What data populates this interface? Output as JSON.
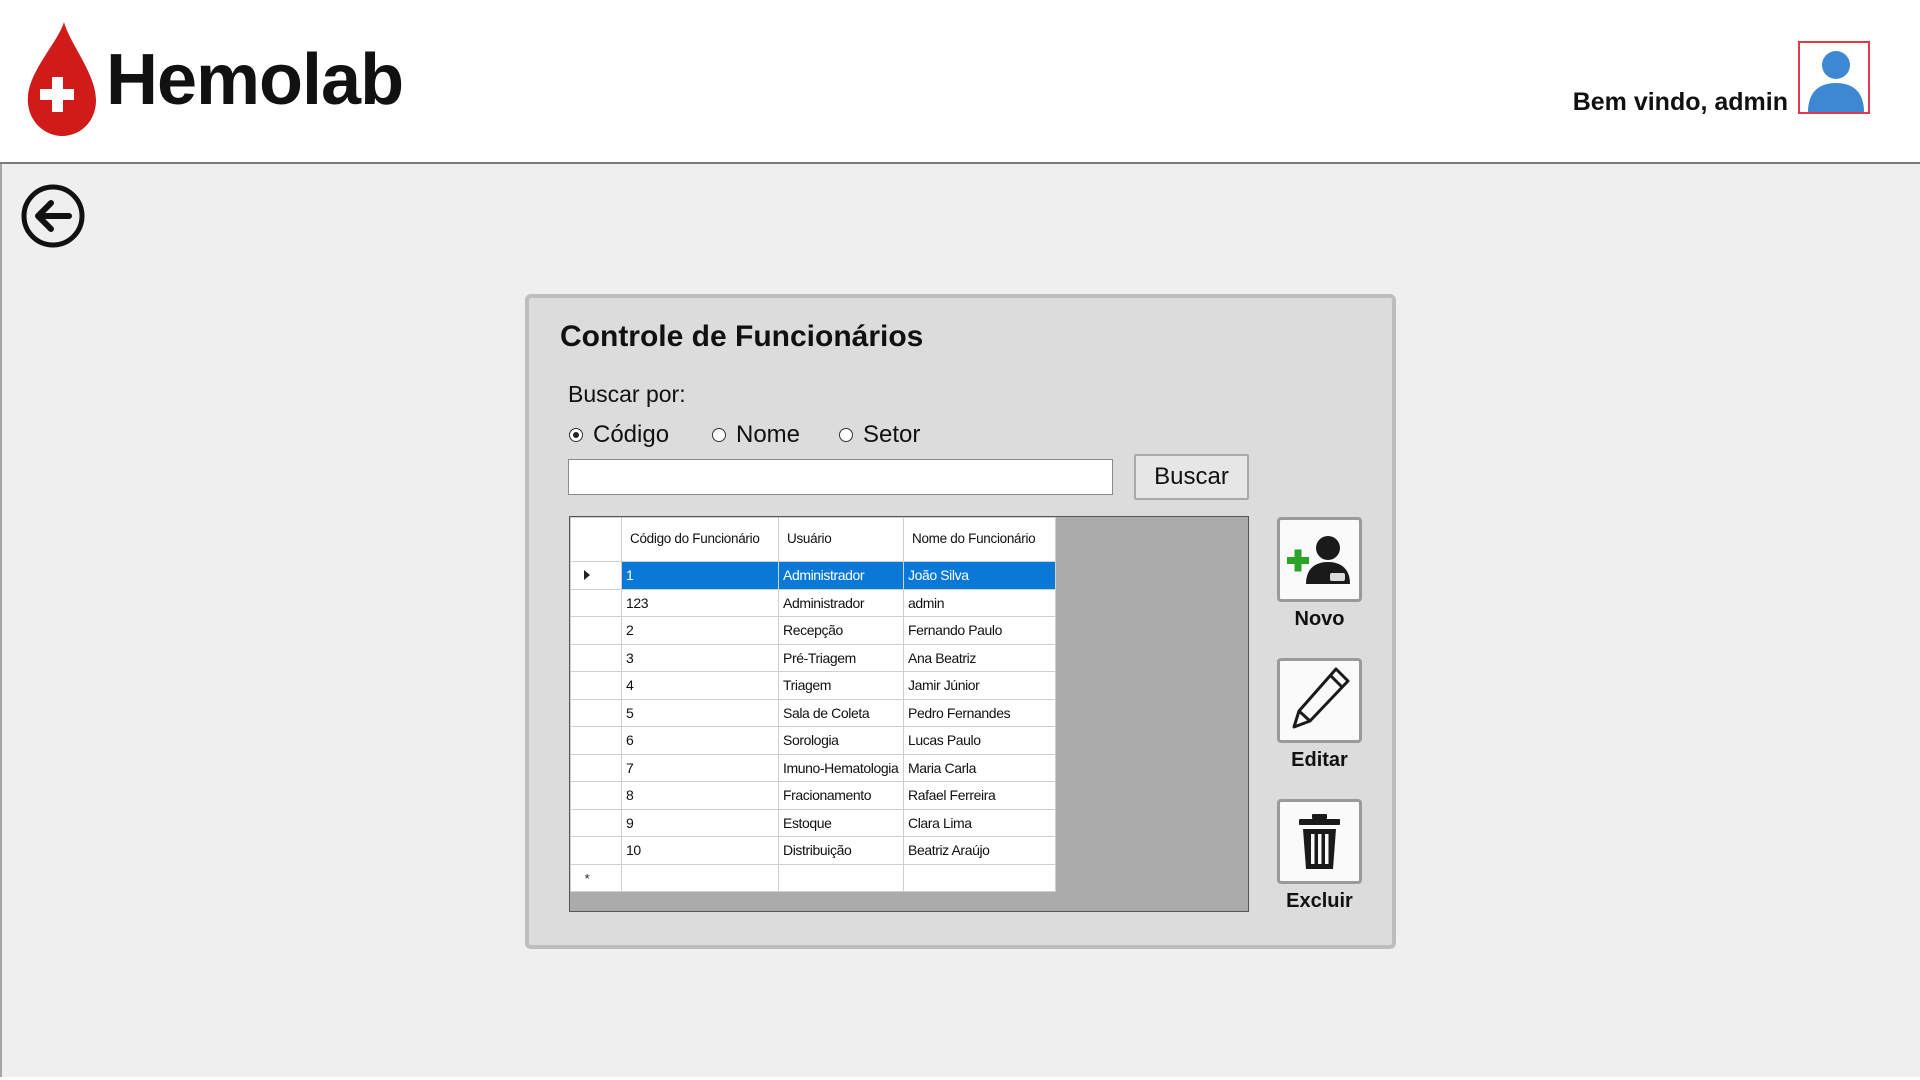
{
  "header": {
    "logo_text": "Hemolab",
    "welcome": "Bem vindo, admin"
  },
  "panel": {
    "title": "Controle de Funcionários",
    "search_label": "Buscar por:",
    "radios": [
      {
        "label": "Código",
        "checked": true
      },
      {
        "label": "Nome",
        "checked": false
      },
      {
        "label": "Setor",
        "checked": false
      }
    ],
    "search_value": "",
    "search_button": "Buscar"
  },
  "grid": {
    "columns": [
      "Código do Funcionário",
      "Usuário",
      "Nome do Funcionário"
    ],
    "rows": [
      [
        "1",
        "Administrador",
        "João Silva"
      ],
      [
        "123",
        "Administrador",
        "admin"
      ],
      [
        "2",
        "Recepção",
        "Fernando Paulo"
      ],
      [
        "3",
        "Pré-Triagem",
        "Ana Beatriz"
      ],
      [
        "4",
        "Triagem",
        "Jamir Júnior"
      ],
      [
        "5",
        "Sala de Coleta",
        "Pedro Fernandes"
      ],
      [
        "6",
        "Sorologia",
        "Lucas Paulo"
      ],
      [
        "7",
        "Imuno-Hematologia",
        "Maria Carla"
      ],
      [
        "8",
        "Fracionamento",
        "Rafael Ferreira"
      ],
      [
        "9",
        "Estoque",
        "Clara Lima"
      ],
      [
        "10",
        "Distribuição",
        "Beatriz Araújo"
      ]
    ],
    "selected_row": 0,
    "new_row_marker": "*"
  },
  "actions": {
    "novo": "Novo",
    "editar": "Editar",
    "excluir": "Excluir"
  },
  "colors": {
    "brand_red": "#d11a1a",
    "selection_blue": "#0a78d7",
    "avatar_blue": "#3d87d3"
  }
}
